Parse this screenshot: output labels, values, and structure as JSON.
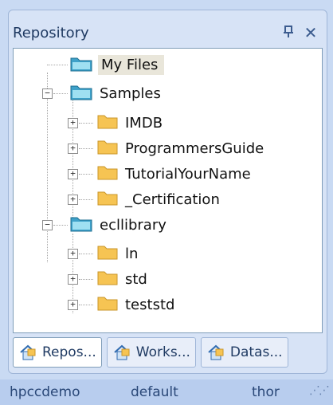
{
  "panel": {
    "title": "Repository",
    "pin_icon": "pin-icon",
    "close_icon": "close-icon"
  },
  "tree": {
    "my_files": "My Files",
    "samples": "Samples",
    "samples_children": [
      "IMDB",
      "ProgrammersGuide",
      "TutorialYourName",
      "_Certification"
    ],
    "ecllibrary": "ecllibrary",
    "ecllibrary_children": [
      "ln",
      "std",
      "teststd"
    ]
  },
  "tabs": [
    {
      "label": "Repos...",
      "icon": "repository-icon"
    },
    {
      "label": "Works...",
      "icon": "workspace-icon"
    },
    {
      "label": "Datas...",
      "icon": "dataset-icon"
    }
  ],
  "status": {
    "server": "hpccdemo",
    "cluster_group": "default",
    "cluster": "thor"
  },
  "colors": {
    "folder": "#f6c453",
    "folder_special": "#3ea1c9",
    "selection": "#e9e6da"
  }
}
